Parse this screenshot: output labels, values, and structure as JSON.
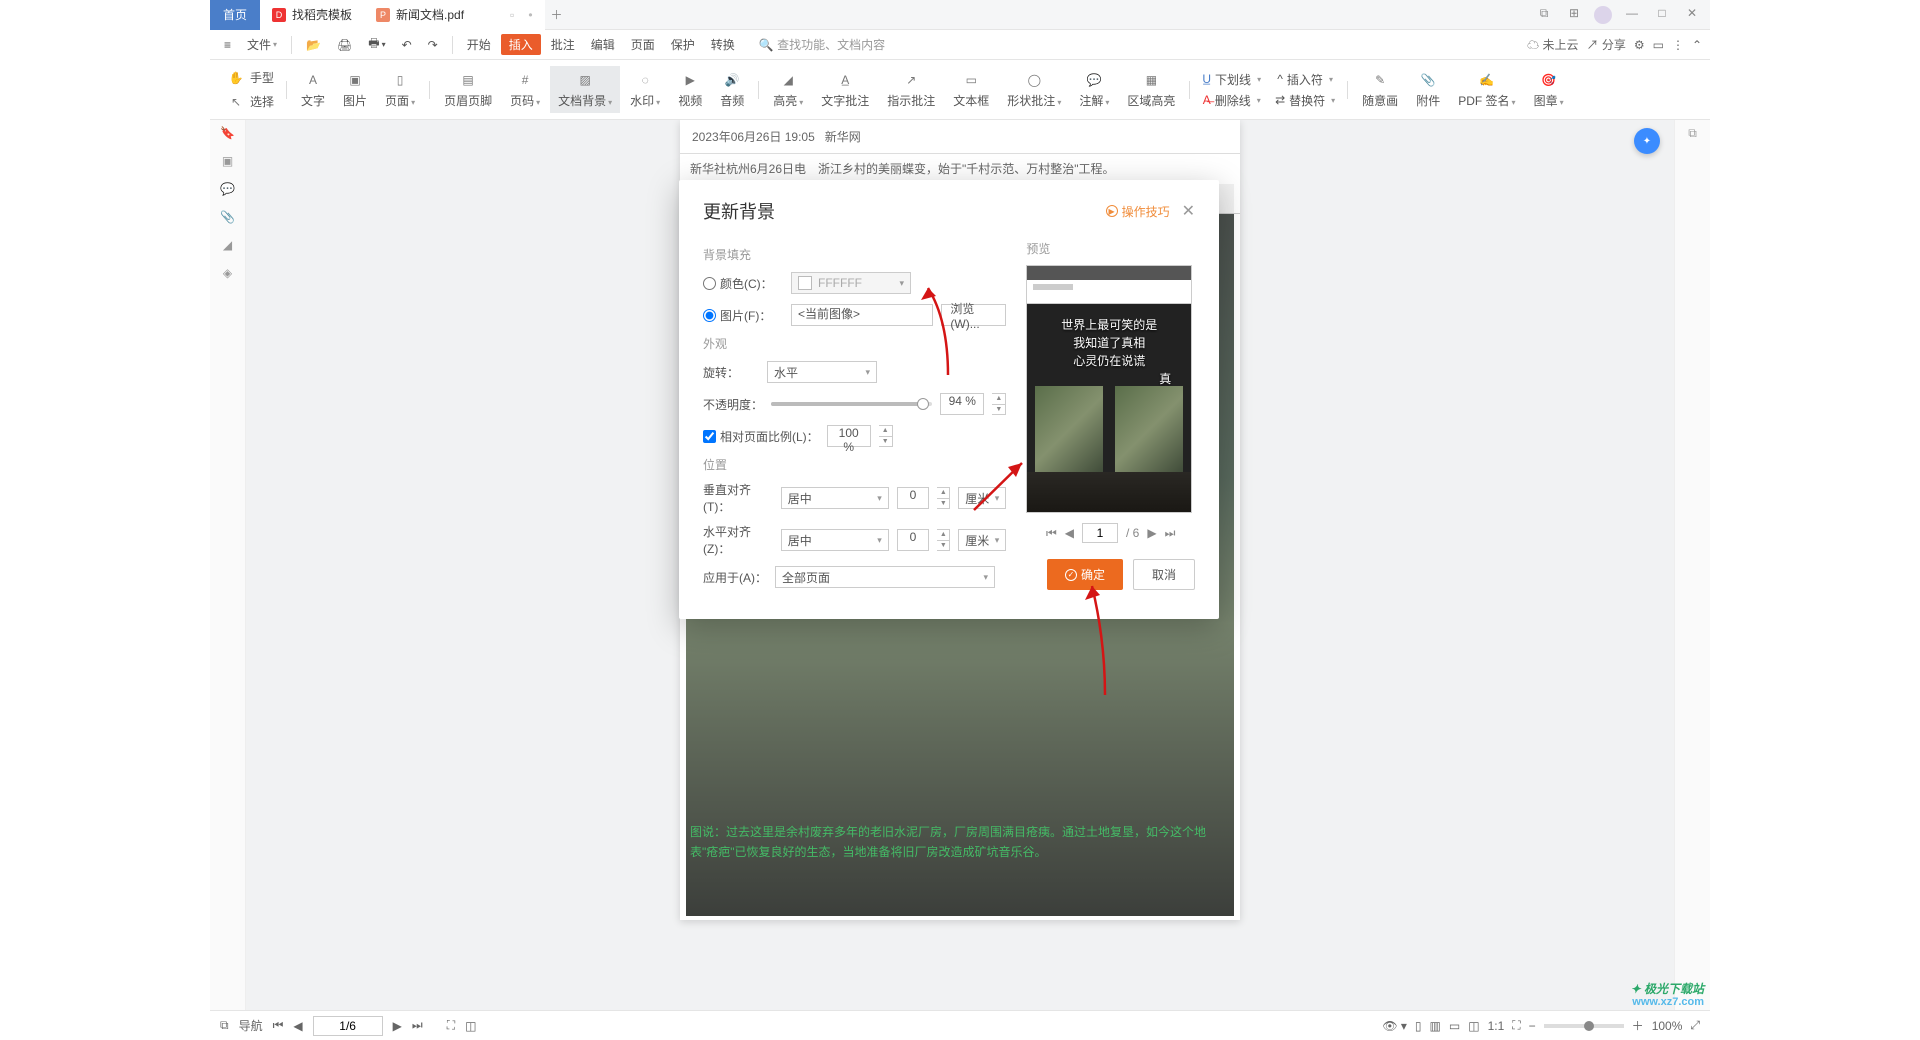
{
  "titlebar": {
    "home": "首页",
    "tab1": "找稻壳模板",
    "tab2": "新闻文档.pdf"
  },
  "menubar": {
    "file": "文件",
    "tabs": [
      "开始",
      "插入",
      "批注",
      "编辑",
      "页面",
      "保护",
      "转换"
    ],
    "active_index": 1,
    "search_placeholder": "查找功能、文档内容",
    "cloud": "未上云",
    "share": "分享"
  },
  "ribbon": {
    "left": [
      {
        "n": "hand",
        "l": "手型"
      },
      {
        "n": "select",
        "l": "选择"
      }
    ],
    "items": [
      {
        "n": "text",
        "l": "文字"
      },
      {
        "n": "image",
        "l": "图片"
      },
      {
        "n": "page",
        "l": "页面",
        "d": true
      },
      {
        "n": "header",
        "l": "页眉页脚"
      },
      {
        "n": "pagenum",
        "l": "页码",
        "d": true
      },
      {
        "n": "docbg",
        "l": "文档背景",
        "d": true,
        "sel": true
      },
      {
        "n": "watermark",
        "l": "水印",
        "d": true
      },
      {
        "n": "video",
        "l": "视频"
      },
      {
        "n": "audio",
        "l": "音频"
      },
      {
        "n": "highlight",
        "l": "高亮",
        "d": true
      },
      {
        "n": "textannot",
        "l": "文字批注"
      },
      {
        "n": "pointannot",
        "l": "指示批注"
      },
      {
        "n": "textbox",
        "l": "文本框"
      },
      {
        "n": "shapeannot",
        "l": "形状批注",
        "d": true
      },
      {
        "n": "comment",
        "l": "注解",
        "d": true
      },
      {
        "n": "areahl",
        "l": "区域高亮"
      }
    ],
    "items2": [
      {
        "n": "underline",
        "l": "下划线",
        "d": true
      },
      {
        "n": "strike",
        "l": "删除线",
        "d": true
      },
      {
        "n": "replace",
        "l": "替换符",
        "d": true
      },
      {
        "n": "insertmark",
        "l": "插入符",
        "d": true
      }
    ],
    "items3": [
      {
        "n": "freedraw",
        "l": "随意画"
      },
      {
        "n": "attachment",
        "l": "附件"
      },
      {
        "n": "pdfsign",
        "l": "PDF 签名",
        "d": true
      },
      {
        "n": "stamp",
        "l": "图章",
        "d": true
      }
    ]
  },
  "page": {
    "timestamp": "2023年06月26日 19:05",
    "source": "新华网",
    "line1": "新华社杭州6月26日电　浙江乡村的美丽蝶变，始于\"千村示范、万村整治\"工程。",
    "caption": "图说：过去这里是余村废弃多年的老旧水泥厂房，厂房周围满目疮痍。通过土地复垦，如今这个地表\"疮疤\"已恢复良好的生态，当地准备将旧厂房改造成矿坑音乐谷。"
  },
  "dialog": {
    "title": "更新背景",
    "tips": "操作技巧",
    "sect_fill": "背景填充",
    "color_label": "颜色(C)：",
    "color_value": "FFFFFF",
    "image_label": "图片(F)：",
    "image_value": "<当前图像>",
    "browse": "浏览(W)...",
    "sect_appear": "外观",
    "rotate_label": "旋转：",
    "rotate_value": "水平",
    "opacity_label": "不透明度：",
    "opacity_value": "94 %",
    "scale_label": "相对页面比例(L)：",
    "scale_value": "100 %",
    "sect_pos": "位置",
    "valign_label": "垂直对齐(T)：",
    "halign_label": "水平对齐(Z)：",
    "align_value": "居中",
    "offset_value": "0",
    "unit": "厘米",
    "apply_label": "应用于(A)：",
    "apply_value": "全部页面",
    "preview_label": "预览",
    "preview_lines": [
      "世界上最可笑的是",
      "我知道了真相",
      "心灵仍在说谎",
      "真"
    ],
    "page_current": "1",
    "page_total": "/ 6",
    "ok": "确定",
    "cancel": "取消"
  },
  "statusbar": {
    "nav": "导航",
    "page": "1/6",
    "zoom": "100%"
  },
  "watermark": {
    "t1": "极光下载站",
    "t2": "www.xz7.com"
  }
}
